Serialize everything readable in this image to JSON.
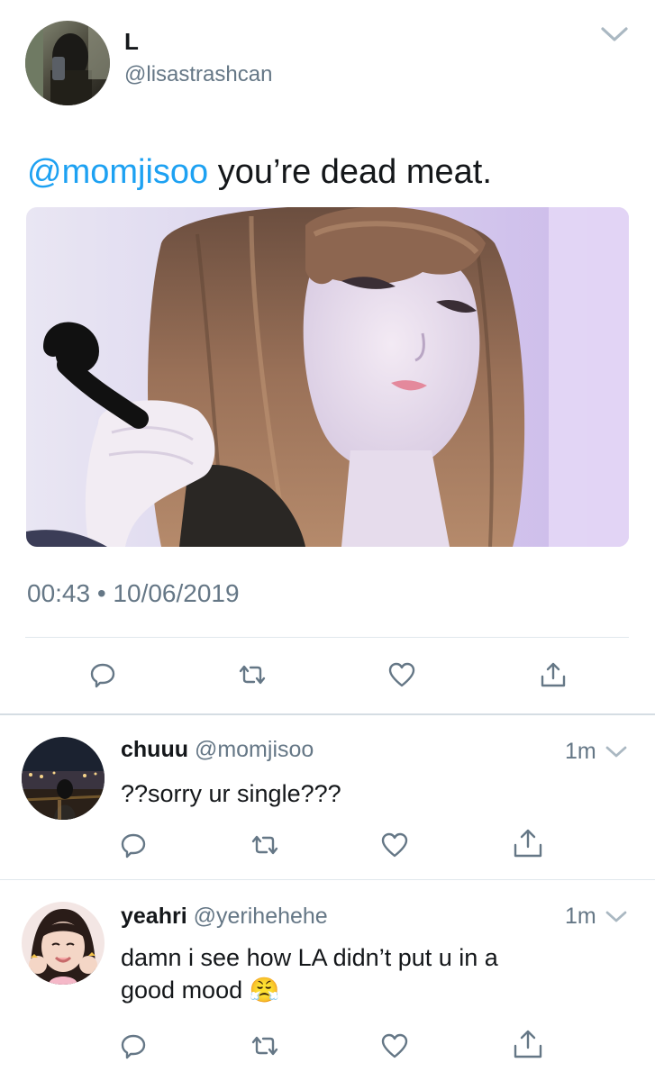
{
  "main_tweet": {
    "display_name": "L",
    "handle": "@lisastrashcan",
    "mention": "@momjisoo",
    "text": " you’re dead meat.",
    "timestamp": "00:43 • 10/06/2019"
  },
  "replies": [
    {
      "display_name": "chuuu",
      "handle": "@momjisoo",
      "time": "1m",
      "text": "??sorry ur single???"
    },
    {
      "display_name": "yeahri",
      "handle": "@yerihehehe",
      "time": "1m",
      "text_line1": "damn i see how LA didn’t put u in a",
      "text_line2": "good mood",
      "emoji": "😤"
    }
  ],
  "icons": {
    "reply": "speech-bubble-icon",
    "retweet": "retweet-icon",
    "like": "heart-icon",
    "share": "share-icon",
    "menu": "chevron-down-icon"
  },
  "colors": {
    "link": "#1da1f2",
    "muted": "#657786",
    "text": "#14171a",
    "divider": "#e1e8ed"
  }
}
